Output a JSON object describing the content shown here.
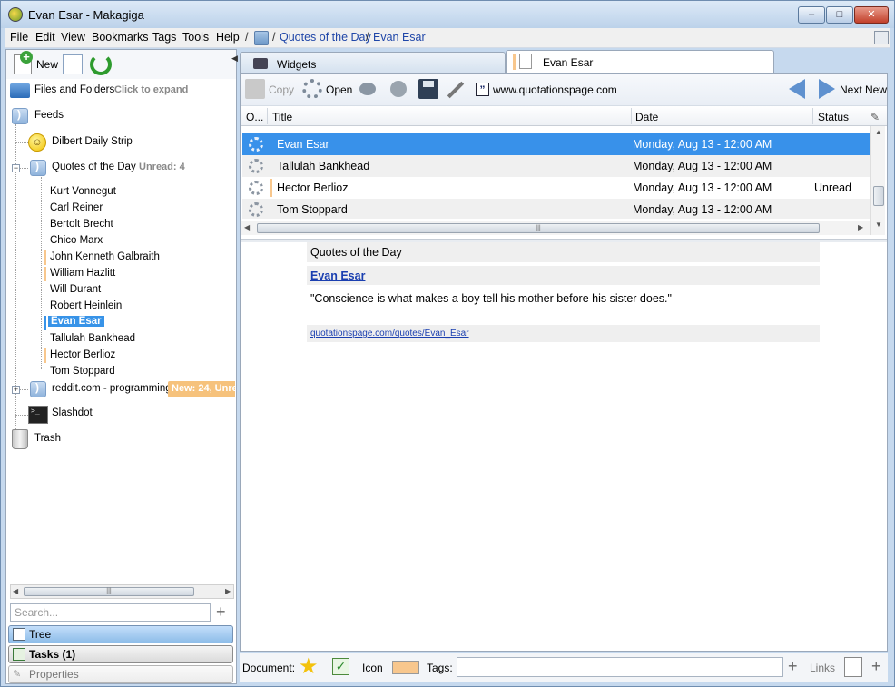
{
  "window": {
    "title": "Evan Esar - Makagiga",
    "min": "–",
    "max": "□",
    "close": "✕"
  },
  "menu": [
    "File",
    "Edit",
    "View",
    "Bookmarks",
    "Tags",
    "Tools",
    "Help"
  ],
  "breadcrumb": {
    "sep": "/",
    "items": [
      "Quotes of the Day",
      "Evan Esar"
    ]
  },
  "left_toolbar": {
    "new_label": "New"
  },
  "tree": {
    "files_folders": "Files and Folders",
    "files_hint": "Click to expand",
    "feeds": "Feeds",
    "dilbert": "Dilbert Daily Strip",
    "quotes": "Quotes of the Day",
    "quotes_unread": "Unread: 4",
    "quote_items": [
      "Kurt Vonnegut",
      "Carl Reiner",
      "Bertolt Brecht",
      "Chico Marx",
      "John Kenneth Galbraith",
      "William Hazlitt",
      "Will Durant",
      "Robert Heinlein",
      "Evan Esar",
      "Tallulah Bankhead",
      "Hector Berlioz",
      "Tom Stoppard"
    ],
    "reddit": "reddit.com - programming",
    "reddit_badge": "New: 24, Unre",
    "slashdot": "Slashdot",
    "trash": "Trash"
  },
  "left_bottom": {
    "search_placeholder": "Search...",
    "tree_tab": "Tree",
    "tasks_tab": "Tasks (1)",
    "props_tab": "Properties"
  },
  "tabs": [
    {
      "label": "Widgets"
    },
    {
      "label": "Evan Esar"
    }
  ],
  "toolbar": {
    "copy": "Copy",
    "open": "Open",
    "site": "www.quotationspage.com",
    "next_new": "Next New"
  },
  "grid": {
    "headers": {
      "o": "O...",
      "title": "Title",
      "date": "Date",
      "status": "Status"
    },
    "rows": [
      {
        "title": "Evan Esar",
        "date": "Monday, Aug 13 - 12:00 AM",
        "status": ""
      },
      {
        "title": "Tallulah Bankhead",
        "date": "Monday, Aug 13 - 12:00 AM",
        "status": ""
      },
      {
        "title": "Hector Berlioz",
        "date": "Monday, Aug 13 - 12:00 AM",
        "status": "Unread"
      },
      {
        "title": "Tom Stoppard",
        "date": "Monday, Aug 13 - 12:00 AM",
        "status": ""
      }
    ]
  },
  "preview": {
    "feed_title": "Quotes of the Day",
    "item_title": "Evan Esar",
    "quote": "\"Conscience is what makes a boy tell his mother before his sister does.\"",
    "url": "quotationspage.com/quotes/Evan_Esar"
  },
  "statusbar": {
    "document": "Document:",
    "icon": "Icon",
    "tags": "Tags:",
    "links": "Links"
  },
  "colors": {
    "selection": "#3891ea",
    "unread_mark": "#f8c78d",
    "link": "#1a3fb0"
  }
}
